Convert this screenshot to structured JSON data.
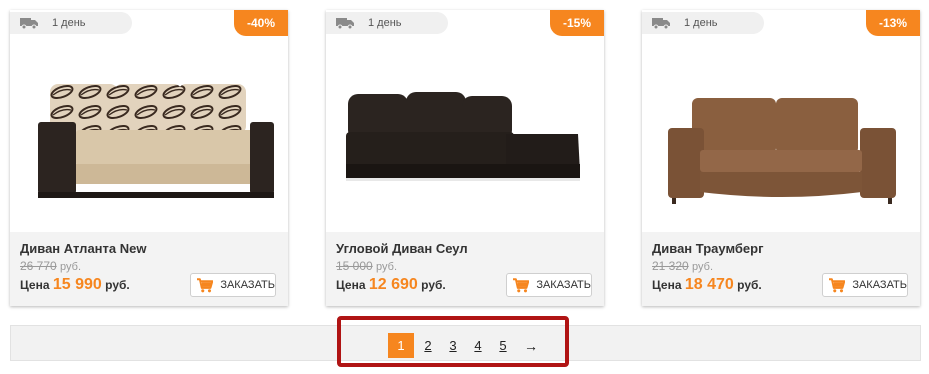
{
  "products": [
    {
      "delivery": "1 день",
      "discount": "-40%",
      "name": "Диван Атланта New",
      "old_price": "26 770",
      "old_price_unit": "руб.",
      "price_label": "Цена",
      "price": "15 990",
      "price_unit": "руб.",
      "order_label": "ЗАКАЗАТЬ"
    },
    {
      "delivery": "1 день",
      "discount": "-15%",
      "name": "Угловой Диван Сеул",
      "old_price": "15 000",
      "old_price_unit": "руб.",
      "price_label": "Цена",
      "price": "12 690",
      "price_unit": "руб.",
      "order_label": "ЗАКАЗАТЬ"
    },
    {
      "delivery": "1 день",
      "discount": "-13%",
      "name": "Диван Траумберг",
      "old_price": "21 320",
      "old_price_unit": "руб.",
      "price_label": "Цена",
      "price": "18 470",
      "price_unit": "руб.",
      "order_label": "ЗАКАЗАТЬ"
    }
  ],
  "pagination": {
    "pages": [
      "1",
      "2",
      "3",
      "4",
      "5"
    ],
    "current": "1",
    "next": "→"
  },
  "colors": {
    "accent": "#f6861f",
    "highlight": "#b01414"
  }
}
